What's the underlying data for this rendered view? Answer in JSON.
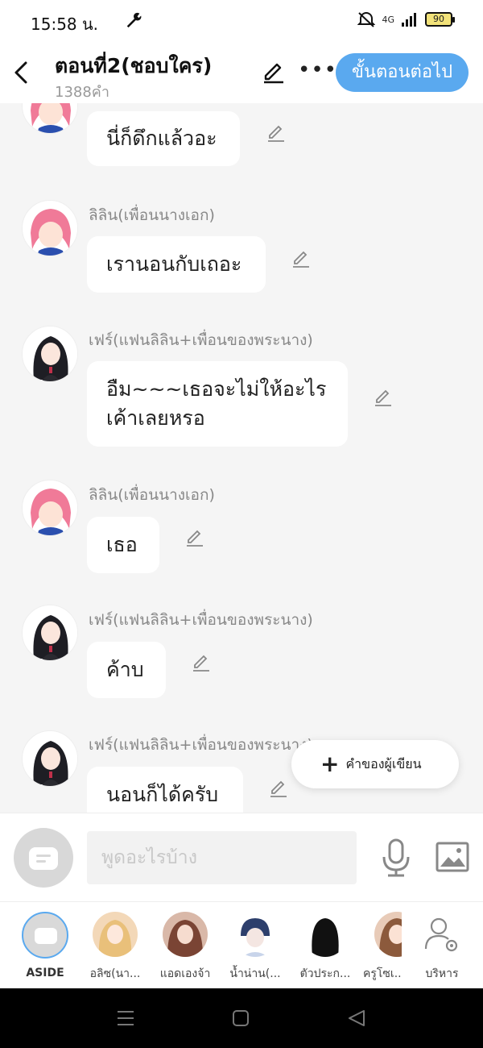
{
  "status_bar": {
    "time": "15:58 น.",
    "signal": "4G",
    "battery": "90"
  },
  "header": {
    "title": "ตอนที่2(ชอบใคร)",
    "word_count": "1388คำ",
    "next_button": "ขั้นตอนต่อไป"
  },
  "messages": [
    {
      "sender": "",
      "text": "นี่ก็ดึกแล้วอะ",
      "avatar": "pink-girl-avatar"
    },
    {
      "sender": "ลิลิน(เพื่อนนางเอก)",
      "text": "เรานอนกับเถอะ",
      "avatar": "pink-girl-avatar"
    },
    {
      "sender": "เฟร์(แฟนลิลิน+เพื่อนของพระนาง)",
      "text": "อืม~~~เธอจะไม่ให้อะไร\nเค้าเลยหรอ",
      "avatar": "dark-hair-girl-avatar"
    },
    {
      "sender": "ลิลิน(เพื่อนนางเอก)",
      "text": "เธอ",
      "avatar": "pink-girl-avatar"
    },
    {
      "sender": "เฟร์(แฟนลิลิน+เพื่อนของพระนาง)",
      "text": "ค้าบ",
      "avatar": "dark-hair-girl-avatar"
    },
    {
      "sender": "เฟร์(แฟนลิลิน+เพื่อนของพระนาง)",
      "text": "นอนก็ได้ครับ",
      "avatar": "dark-hair-girl-avatar"
    }
  ],
  "author_note_button": "คำของผู้เขียน",
  "composer": {
    "placeholder": "พูดอะไรบ้าง"
  },
  "characters": [
    {
      "label": "ASIDE"
    },
    {
      "label": "อลิซ(นา..."
    },
    {
      "label": "แอดเองจ้า"
    },
    {
      "label": "น้ำน่าน(..."
    },
    {
      "label": "ตัวประก..."
    },
    {
      "label": "ครูโซเ..."
    },
    {
      "label": "บริหาร"
    }
  ],
  "colors": {
    "accent": "#5aa9ef",
    "background": "#f5f5f5",
    "bubble": "#ffffff"
  }
}
